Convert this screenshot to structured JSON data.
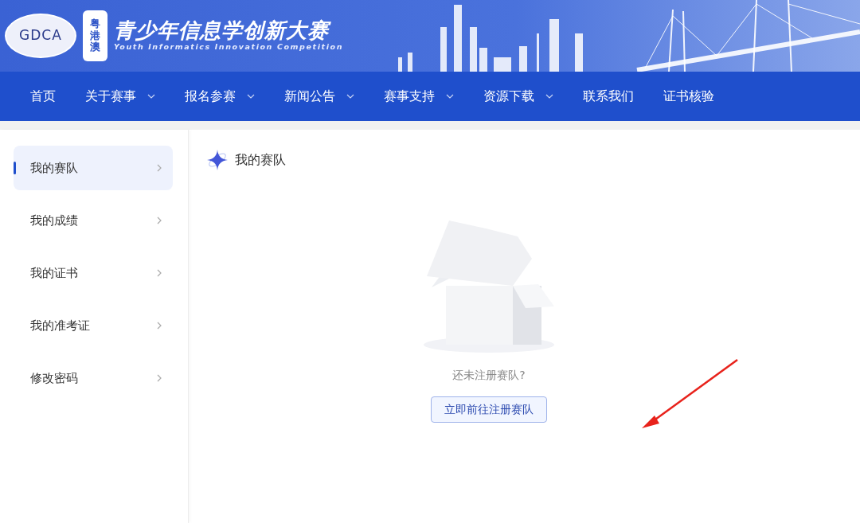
{
  "header": {
    "logo_text": "GDCA",
    "region_badge": "粤港澳",
    "title": "青少年信息学创新大赛",
    "subtitle": "Youth Informatics Innovation Competition"
  },
  "nav": [
    {
      "label": "首页",
      "has_dropdown": false
    },
    {
      "label": "关于赛事",
      "has_dropdown": true
    },
    {
      "label": "报名参赛",
      "has_dropdown": true
    },
    {
      "label": "新闻公告",
      "has_dropdown": true
    },
    {
      "label": "赛事支持",
      "has_dropdown": true
    },
    {
      "label": "资源下载",
      "has_dropdown": true
    },
    {
      "label": "联系我们",
      "has_dropdown": false
    },
    {
      "label": "证书核验",
      "has_dropdown": false
    }
  ],
  "sidebar": {
    "items": [
      {
        "label": "我的赛队",
        "selected": true
      },
      {
        "label": "我的成绩",
        "selected": false
      },
      {
        "label": "我的证书",
        "selected": false
      },
      {
        "label": "我的准考证",
        "selected": false
      },
      {
        "label": "修改密码",
        "selected": false
      }
    ]
  },
  "content": {
    "title": "我的赛队",
    "empty_message": "还未注册赛队?",
    "action_button": "立即前往注册赛队"
  }
}
